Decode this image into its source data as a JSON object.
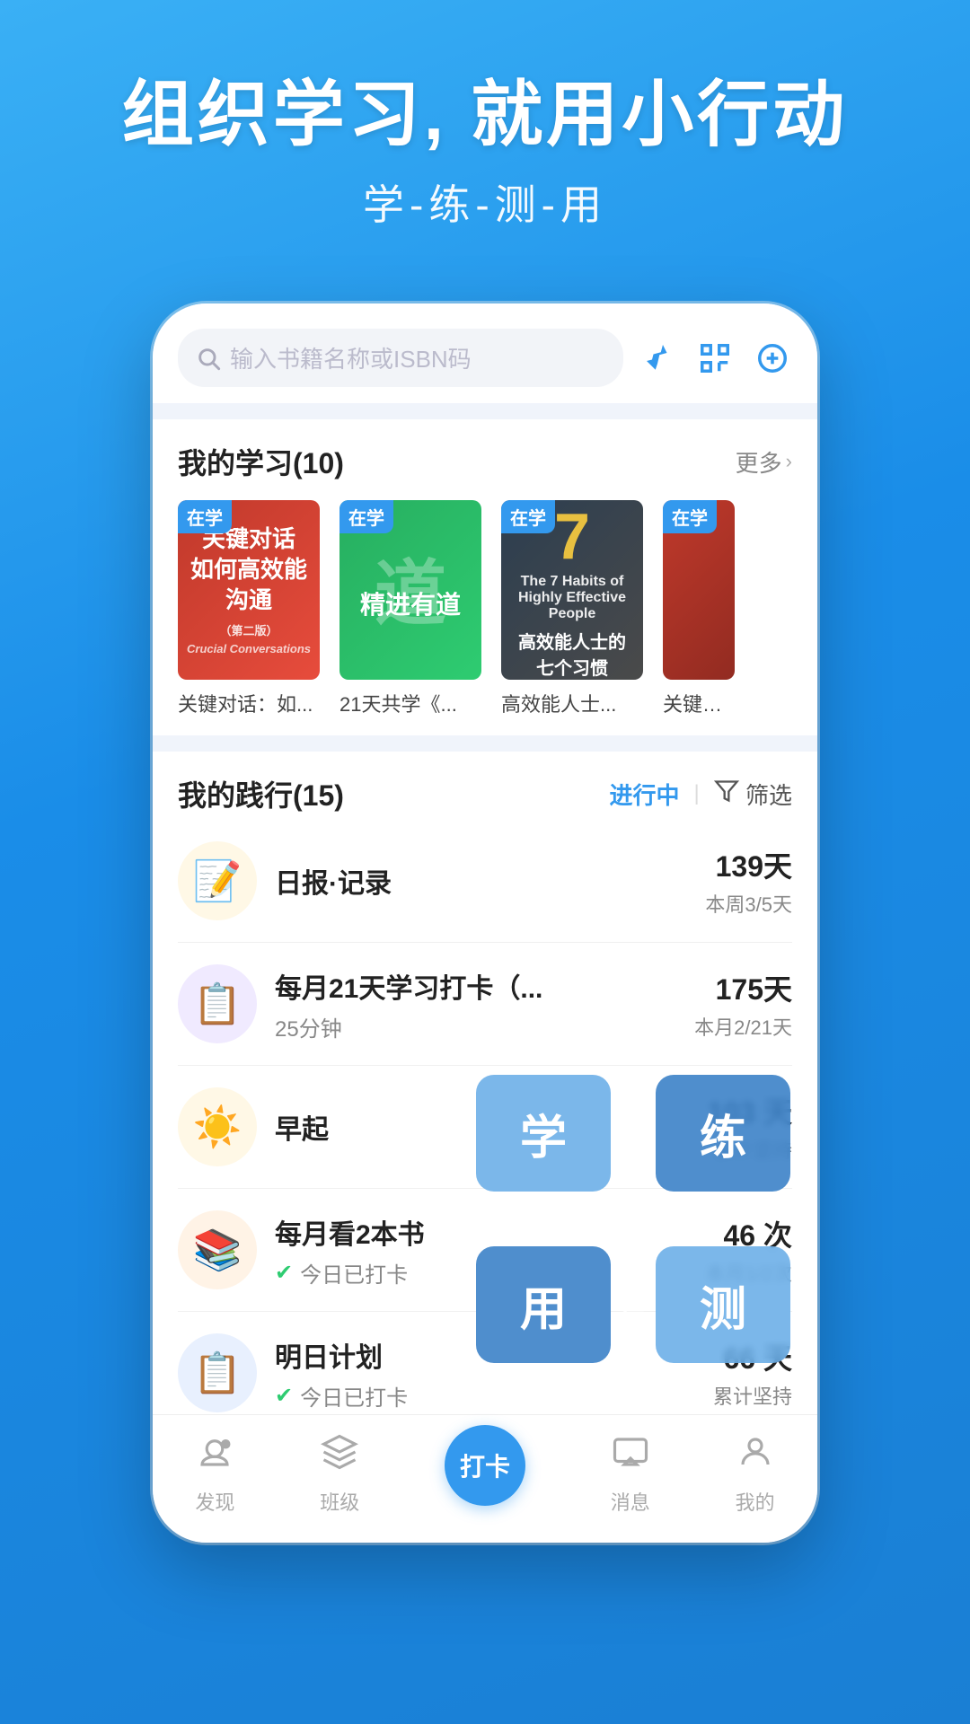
{
  "hero": {
    "title": "组织学习, 就用小行动",
    "subtitle": "学-练-测-用"
  },
  "search": {
    "placeholder": "输入书籍名称或ISBN码"
  },
  "my_learning": {
    "section_title": "我的学习",
    "count": "(10)",
    "more_label": "更多",
    "books": [
      {
        "title": "关键对话：如...",
        "status": "在学",
        "cover_type": "red",
        "cover_text": "关键对话",
        "cover_sub": "如何高效能沟通",
        "cover_en": "Crucial Conversations"
      },
      {
        "title": "21天共学《...",
        "status": "在学",
        "cover_type": "green",
        "cover_text": "精进有道",
        "cover_sub": ""
      },
      {
        "title": "高效能人士...",
        "status": "在学",
        "cover_type": "dark",
        "cover_text": "高效能人士的7个习惯",
        "cover_sub": ""
      },
      {
        "title": "关键对...",
        "status": "在学",
        "cover_type": "pink",
        "cover_text": "",
        "cover_sub": ""
      }
    ]
  },
  "my_practice": {
    "section_title": "我的践行",
    "count": "(15)",
    "filter_active": "进行中",
    "filter_label": "筛选",
    "items": [
      {
        "icon": "📝",
        "icon_bg": "yellow",
        "name": "日报·记录",
        "sub": "",
        "days": "139天",
        "stat_sub": "本周3/5天"
      },
      {
        "icon": "📋",
        "icon_bg": "purple",
        "name": "每月21天学习打卡（...",
        "sub": "25分钟",
        "days": "175天",
        "stat_sub": "本月2/21天"
      },
      {
        "icon": "☀️",
        "icon_bg": "yellow",
        "name": "早起",
        "sub": "",
        "days": "103 天",
        "stat_sub": "累计坚持"
      },
      {
        "icon": "📚",
        "icon_bg": "orange",
        "name": "每月看2本书",
        "sub": "今日已打卡",
        "checked": true,
        "days": "46 次",
        "stat_sub": "本月1/2次"
      },
      {
        "icon": "📋",
        "icon_bg": "blue",
        "name": "明日计划",
        "sub": "今日已打卡",
        "checked": true,
        "days": "66 天",
        "stat_sub": "累计坚持"
      }
    ]
  },
  "flow_diagram": {
    "btn_learn": "学",
    "btn_practice": "练",
    "btn_test": "测",
    "btn_use": "用"
  },
  "bottom_nav": {
    "items": [
      {
        "label": "发现",
        "icon": "discover",
        "active": false
      },
      {
        "label": "班级",
        "icon": "class",
        "active": false
      },
      {
        "label": "打卡",
        "icon": "checkin",
        "active": true,
        "center": true
      },
      {
        "label": "消息",
        "icon": "message",
        "active": false
      },
      {
        "label": "我的",
        "icon": "profile",
        "active": false
      }
    ]
  }
}
